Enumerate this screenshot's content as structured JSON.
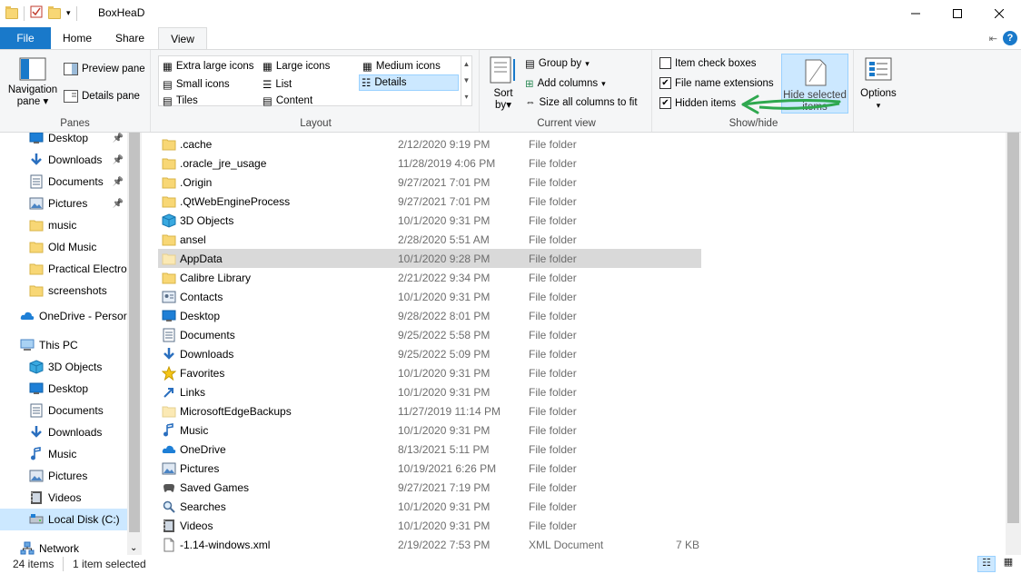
{
  "window": {
    "title": "BoxHeaD",
    "minimize_icon": "minimize-icon",
    "maximize_icon": "maximize-icon",
    "close_icon": "close-icon"
  },
  "ribbon_tabs": [
    {
      "label": "File"
    },
    {
      "label": "Home"
    },
    {
      "label": "Share"
    },
    {
      "label": "View"
    }
  ],
  "ribbon": {
    "panes": {
      "navigation_pane": "Navigation",
      "navigation_pane2": "pane",
      "preview_pane": "Preview pane",
      "details_pane": "Details pane",
      "group_label": "Panes"
    },
    "layout": {
      "options": [
        "Extra large icons",
        "Large icons",
        "Medium icons",
        "Small icons",
        "List",
        "Details",
        "Tiles",
        "Content"
      ],
      "selected": "Details",
      "group_label": "Layout"
    },
    "current_view": {
      "sort_by": "Sort",
      "sort_by2": "by",
      "group_by": "Group by",
      "add_columns": "Add columns",
      "size_all_columns": "Size all columns to fit",
      "group_label": "Current view"
    },
    "show_hide": {
      "item_check_boxes": "Item check boxes",
      "file_name_extensions": "File name extensions",
      "hidden_items": "Hidden items",
      "hide_selected": "Hide selected",
      "hide_selected2": "items",
      "group_label": "Show/hide",
      "item_check_boxes_checked": false,
      "file_name_extensions_checked": true,
      "hidden_items_checked": true
    },
    "options": {
      "label": "Options"
    }
  },
  "nav_pane": {
    "items": [
      {
        "label": "Desktop",
        "icon": "desktop-icon",
        "pinned": true
      },
      {
        "label": "Downloads",
        "icon": "downloads-icon",
        "pinned": true
      },
      {
        "label": "Documents",
        "icon": "documents-icon",
        "pinned": true
      },
      {
        "label": "Pictures",
        "icon": "pictures-icon",
        "pinned": true
      },
      {
        "label": "music",
        "icon": "folder-icon",
        "pinned": false
      },
      {
        "label": "Old Music",
        "icon": "folder-icon",
        "pinned": false
      },
      {
        "label": "Practical Electron",
        "icon": "folder-icon",
        "pinned": false
      },
      {
        "label": "screenshots",
        "icon": "folder-icon",
        "pinned": false
      },
      {
        "label": "OneDrive - Persor",
        "icon": "onedrive-icon",
        "pinned": false
      },
      {
        "label": "This PC",
        "icon": "this-pc-icon",
        "pinned": false
      },
      {
        "label": "3D Objects",
        "icon": "3d-objects-icon",
        "pinned": false
      },
      {
        "label": "Desktop",
        "icon": "desktop-icon",
        "pinned": false
      },
      {
        "label": "Documents",
        "icon": "documents-icon",
        "pinned": false
      },
      {
        "label": "Downloads",
        "icon": "downloads-icon",
        "pinned": false
      },
      {
        "label": "Music",
        "icon": "music-icon",
        "pinned": false
      },
      {
        "label": "Pictures",
        "icon": "pictures-icon",
        "pinned": false
      },
      {
        "label": "Videos",
        "icon": "videos-icon",
        "pinned": false
      },
      {
        "label": "Local Disk (C:)",
        "icon": "local-disk-icon",
        "pinned": false,
        "selected": true
      },
      {
        "label": "Network",
        "icon": "network-icon",
        "pinned": false
      }
    ]
  },
  "files": [
    {
      "name": ".cache",
      "date": "2/12/2020 9:19 PM",
      "type": "File folder",
      "size": "",
      "icon": "folder-icon"
    },
    {
      "name": ".oracle_jre_usage",
      "date": "11/28/2019 4:06 PM",
      "type": "File folder",
      "size": "",
      "icon": "folder-icon"
    },
    {
      "name": ".Origin",
      "date": "9/27/2021 7:01 PM",
      "type": "File folder",
      "size": "",
      "icon": "folder-icon"
    },
    {
      "name": ".QtWebEngineProcess",
      "date": "9/27/2021 7:01 PM",
      "type": "File folder",
      "size": "",
      "icon": "folder-icon"
    },
    {
      "name": "3D Objects",
      "date": "10/1/2020 9:31 PM",
      "type": "File folder",
      "size": "",
      "icon": "3d-objects-icon"
    },
    {
      "name": "ansel",
      "date": "2/28/2020 5:51 AM",
      "type": "File folder",
      "size": "",
      "icon": "folder-icon"
    },
    {
      "name": "AppData",
      "date": "10/1/2020 9:28 PM",
      "type": "File folder",
      "size": "",
      "icon": "folder-faded-icon",
      "selected": true
    },
    {
      "name": "Calibre Library",
      "date": "2/21/2022 9:34 PM",
      "type": "File folder",
      "size": "",
      "icon": "folder-icon"
    },
    {
      "name": "Contacts",
      "date": "10/1/2020 9:31 PM",
      "type": "File folder",
      "size": "",
      "icon": "contacts-icon"
    },
    {
      "name": "Desktop",
      "date": "9/28/2022 8:01 PM",
      "type": "File folder",
      "size": "",
      "icon": "desktop-icon"
    },
    {
      "name": "Documents",
      "date": "9/25/2022 5:58 PM",
      "type": "File folder",
      "size": "",
      "icon": "documents-icon"
    },
    {
      "name": "Downloads",
      "date": "9/25/2022 5:09 PM",
      "type": "File folder",
      "size": "",
      "icon": "downloads-icon"
    },
    {
      "name": "Favorites",
      "date": "10/1/2020 9:31 PM",
      "type": "File folder",
      "size": "",
      "icon": "favorites-icon"
    },
    {
      "name": "Links",
      "date": "10/1/2020 9:31 PM",
      "type": "File folder",
      "size": "",
      "icon": "links-icon"
    },
    {
      "name": "MicrosoftEdgeBackups",
      "date": "11/27/2019 11:14 PM",
      "type": "File folder",
      "size": "",
      "icon": "folder-faded-icon"
    },
    {
      "name": "Music",
      "date": "10/1/2020 9:31 PM",
      "type": "File folder",
      "size": "",
      "icon": "music-icon"
    },
    {
      "name": "OneDrive",
      "date": "8/13/2021 5:11 PM",
      "type": "File folder",
      "size": "",
      "icon": "onedrive-icon"
    },
    {
      "name": "Pictures",
      "date": "10/19/2021 6:26 PM",
      "type": "File folder",
      "size": "",
      "icon": "pictures-icon"
    },
    {
      "name": "Saved Games",
      "date": "9/27/2021 7:19 PM",
      "type": "File folder",
      "size": "",
      "icon": "saved-games-icon"
    },
    {
      "name": "Searches",
      "date": "10/1/2020 9:31 PM",
      "type": "File folder",
      "size": "",
      "icon": "searches-icon"
    },
    {
      "name": "Videos",
      "date": "10/1/2020 9:31 PM",
      "type": "File folder",
      "size": "",
      "icon": "videos-icon"
    },
    {
      "name": "-1.14-windows.xml",
      "date": "2/19/2022 7:53 PM",
      "type": "XML Document",
      "size": "7 KB",
      "icon": "xml-file-icon"
    }
  ],
  "status": {
    "item_count": "24 items",
    "selected": "1 item selected"
  },
  "colors": {
    "accent": "#1979ca",
    "selection": "#cce8ff",
    "annotation_arrow": "#2fa84f"
  }
}
